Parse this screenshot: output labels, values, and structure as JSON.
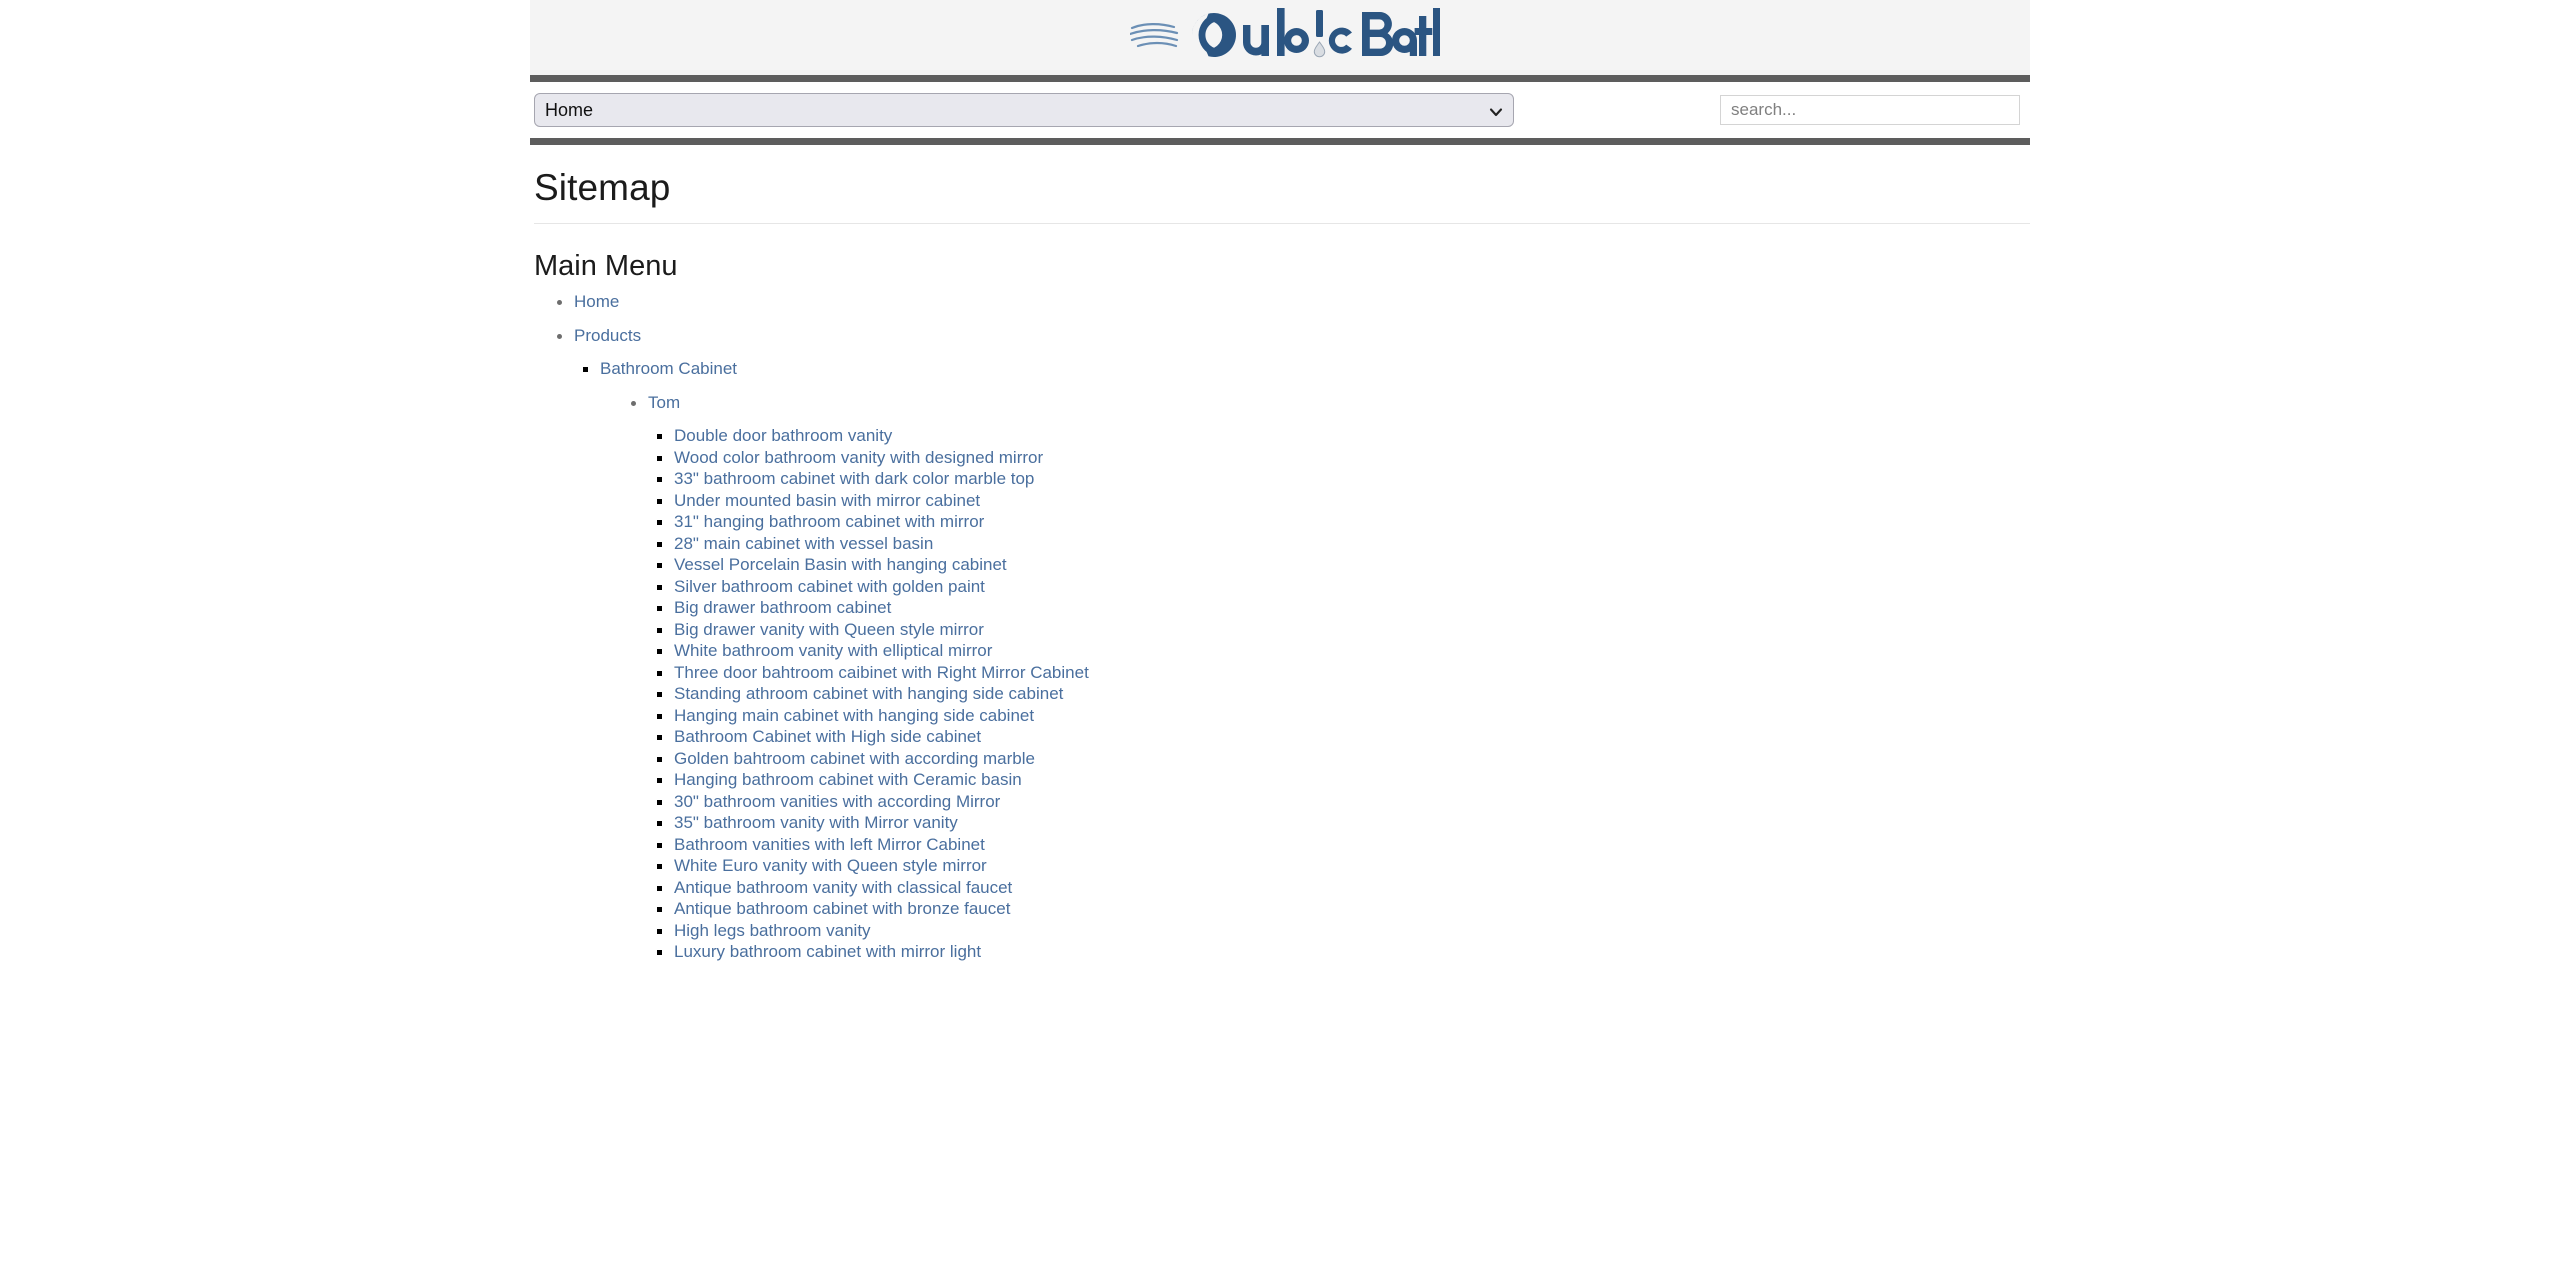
{
  "site": {
    "logo_text": "Cub!cBath",
    "logo_primary_color": "#2b5582",
    "logo_secondary_color": "#4a7ba8",
    "header_background": "#f4f4f4",
    "rule_color": "#5d5d5d",
    "link_color": "#4a6f9e"
  },
  "nav": {
    "menu_label": "Home",
    "menu_options": [
      "Home"
    ],
    "chevron_icon": "chevron-down-icon"
  },
  "search": {
    "placeholder": "search...",
    "value": ""
  },
  "main": {
    "page_title": "Sitemap",
    "section_title": "Main Menu"
  },
  "sitemap": {
    "top_items": [
      {
        "label": "Home"
      },
      {
        "label": "Products"
      }
    ],
    "category": {
      "label": "Bathroom Cabinet"
    },
    "subcategory": {
      "label": "Tom"
    },
    "products": [
      "Double door bathroom vanity",
      "Wood color bathroom vanity with designed mirror",
      "33\" bathroom cabinet with dark color marble top",
      "Under mounted basin with mirror cabinet",
      "31\" hanging bathroom cabinet with mirror",
      "28\" main cabinet with vessel basin",
      "Vessel Porcelain Basin with hanging cabinet",
      "Silver bathroom cabinet with golden paint",
      "Big drawer bathroom cabinet",
      "Big drawer vanity with Queen style mirror",
      "White bathroom vanity with elliptical mirror",
      "Three door bahtroom caibinet with Right Mirror Cabinet",
      "Standing athroom cabinet with hanging side cabinet",
      "Hanging main cabinet with hanging side cabinet",
      "Bathroom Cabinet with High side cabinet",
      "Golden bahtroom cabinet with according marble",
      "Hanging bathroom cabinet with Ceramic basin",
      "30\" bathroom vanities with according Mirror",
      "35\" bathroom vanity with Mirror vanity",
      "Bathroom vanities with left Mirror Cabinet",
      "White Euro vanity with Queen style mirror",
      "Antique bathroom vanity with classical faucet",
      "Antique bathroom cabinet with bronze faucet",
      "High legs bathroom vanity",
      "Luxury bathroom cabinet with mirror light"
    ]
  }
}
